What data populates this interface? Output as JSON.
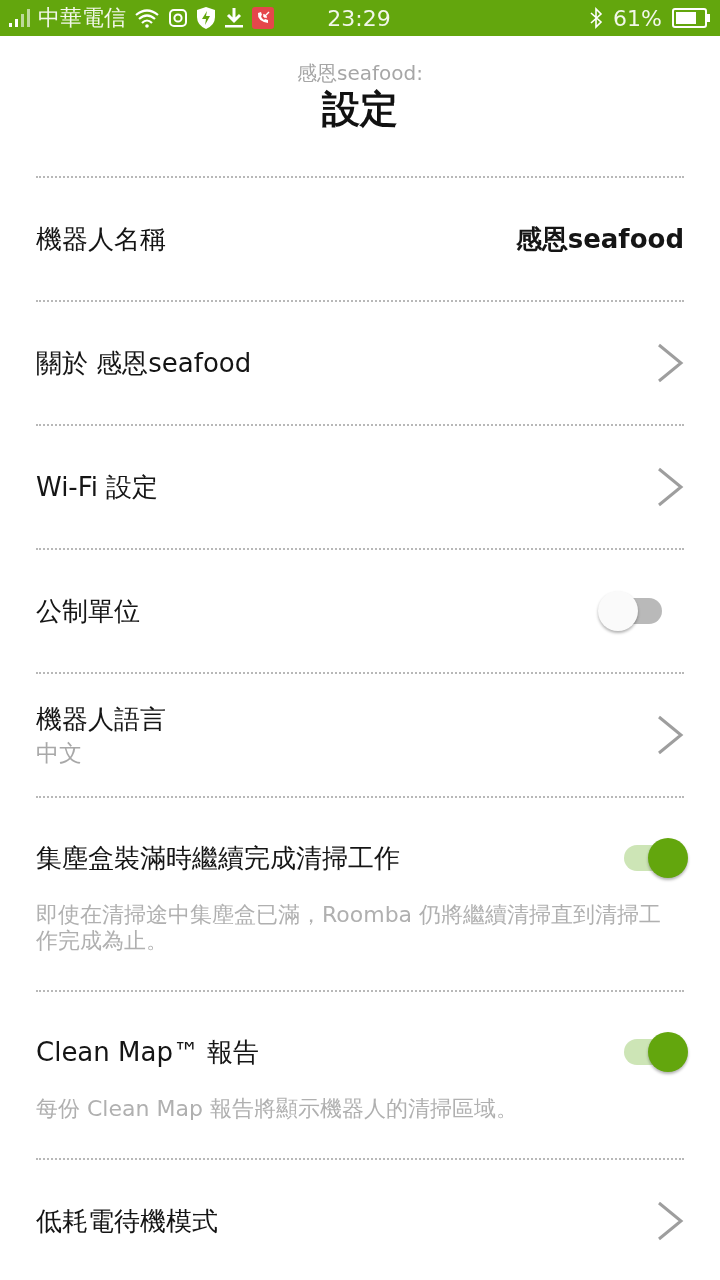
{
  "status_bar": {
    "carrier": "中華電信",
    "time": "23:29",
    "battery": "61%"
  },
  "header": {
    "subtitle": "感恩seafood:",
    "title": "設定"
  },
  "rows": [
    {
      "kind": "value",
      "label": "機器人名稱",
      "value": "感恩seafood"
    },
    {
      "kind": "link",
      "label": "關於 感恩seafood"
    },
    {
      "kind": "link",
      "label": "Wi-Fi 設定"
    },
    {
      "kind": "toggle",
      "label": "公制單位",
      "on": false
    },
    {
      "kind": "link",
      "label": "機器人語言",
      "value": "中文"
    },
    {
      "kind": "toggle",
      "label": "集塵盒裝滿時繼續完成清掃工作",
      "on": true,
      "description": "即使在清掃途中集塵盒已滿，Roomba 仍將繼續清掃直到清掃工作完成為止。"
    },
    {
      "kind": "toggle",
      "label": "Clean Map™ 報告",
      "on": true,
      "description": "每份 Clean Map 報告將顯示機器人的清掃區域。"
    },
    {
      "kind": "link",
      "label": "低耗電待機模式"
    }
  ]
}
